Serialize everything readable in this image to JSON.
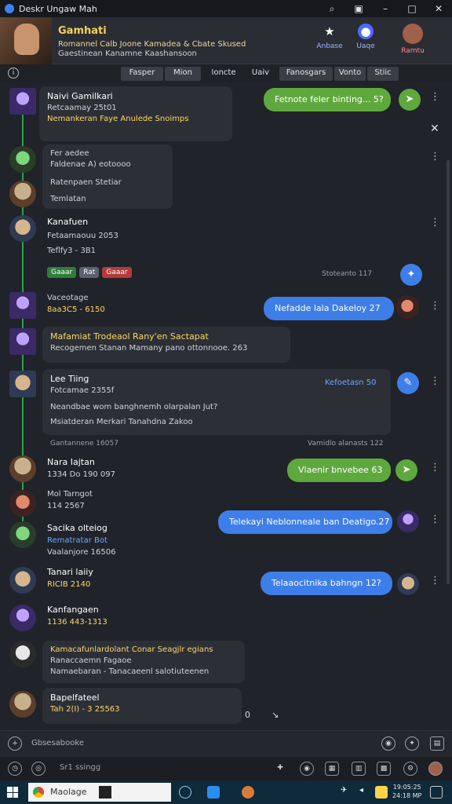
{
  "window": {
    "title": "Deskr Ungaw Mah"
  },
  "header": {
    "name": "Gamhati",
    "sub1": "Romannel Calb Joone Kamadea & Cbate Skused",
    "sub2": "Gaestinean Kanamne Kaashansoon",
    "buttons": [
      {
        "label": "Anbase",
        "icon": "star-icon"
      },
      {
        "label": "Uaqe",
        "icon": "discord-icon"
      },
      {
        "label": "Ramtu",
        "icon": "profile-icon"
      }
    ]
  },
  "tabs": [
    "Fasper",
    "Mion",
    "Ioncte",
    "Uaiv",
    "Fanosgars",
    "Vonto",
    "Stiic"
  ],
  "messages": {
    "m1": {
      "name": "Naivi Gamilkari",
      "meta": "Retcaamay 25t01",
      "line": "Nemankeran Faye Anulede Snoimps"
    },
    "m2": {
      "name": "Fer aedee",
      "meta": "Faldenae A) eotoooo",
      "line1": "Ratenpaen Stetiar",
      "line2": "Temlatan"
    },
    "m3": {
      "name": "Kanafuen",
      "meta": "Fetaamaouu 2053",
      "line": "Teflfy3 - 3B1",
      "reacts": [
        "Gaaar",
        "Rat",
        "Gaaar"
      ],
      "stamp": "Stoteanto 117"
    },
    "m4": {
      "name": "Vaceotage",
      "meta": "8aa3C5 - 6150"
    },
    "m5": {
      "name": "Mafamiat Trodeaol Rany'en Sactapat",
      "line": "Recogemen Stanan Mamany pano ottonnooe. 263"
    },
    "m6": {
      "name": "Lee Tiing",
      "meta": "Fotcamae 2355f",
      "line1": "Neandbae wom banghnemh olarpalan Jut?",
      "line2": "Msiatderan Merkari Tanahdna Zakoo",
      "stamp": "Gantannene 16057",
      "stamp2": "Vamidlo alanasts 122"
    },
    "m7": {
      "name": "Nara Iajtan",
      "meta": "1334 Do 190 097"
    },
    "m8": {
      "name": "Mol Tarngot",
      "meta": "114 2567"
    },
    "m9": {
      "name": "Sacika olteiog",
      "line1": "Rematratar Bot",
      "line2": "Vaalanjore 16506"
    },
    "m10": {
      "name": "Tanari laiiy",
      "meta": "RICIB 2140"
    },
    "m11": {
      "name": "Kanfangaen",
      "meta": "1136 443-1313"
    },
    "m12": {
      "name": "Kamacafunlardolant Conar Seagjlr egians",
      "line1": "Ranaccaemn Fagaoe",
      "line2": "Namaebaran - Tanacaeenl salotiuteenen"
    },
    "m13": {
      "name": "Bapelfateel",
      "meta": "Tah 2(I) - 3 25563"
    }
  },
  "outgoing": {
    "o1": "Fetnote feler binting... 5?",
    "o2": "Nefadde lala Dakeloy 27",
    "o3": "Kefoetasn 50",
    "o4": "Vlaenir bnvebee 63",
    "o5": "Telekayi Neblonneale ban Deatigo.27",
    "o6": "Telaaocitnika bahngn 12?"
  },
  "input": {
    "placeholder": "Gbsesabooke"
  },
  "toolrow": {
    "placeholder": "Sr1 ssingg"
  },
  "taskbar": {
    "search": "Maolage",
    "time": "19:05:25",
    "date": "24:18 MP"
  },
  "colors": {
    "accent_green": "#5fa83d",
    "accent_blue": "#3e7ee8",
    "name_yellow": "#f6d25a"
  }
}
